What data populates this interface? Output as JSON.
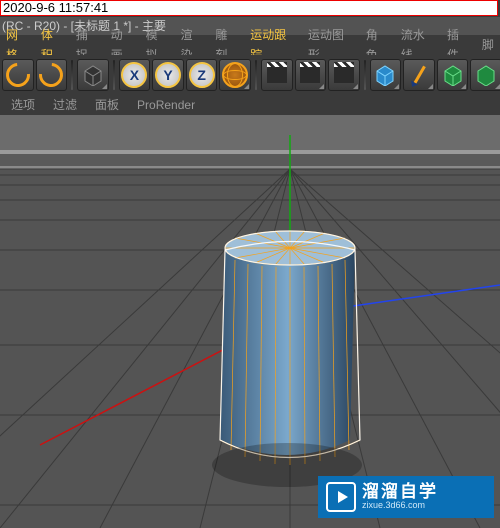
{
  "timestamp": "2020-9-6 11:57:41",
  "window_title": "(RC - R20) - [未标题 1 *] - 主要",
  "menu": {
    "items": [
      "网格",
      "体积",
      "捕捉",
      "动画",
      "模拟",
      "渲染",
      "雕刻",
      "运动跟踪",
      "运动图形",
      "角色",
      "流水线",
      "插件",
      "脚"
    ],
    "highlighted_indexes": [
      0,
      1,
      7
    ]
  },
  "toolbar": {
    "undo_icon": "undo-icon",
    "redo_icon": "redo-icon",
    "cube_mode_icon": "cube-mode-icon",
    "axis_x": "X",
    "axis_y": "Y",
    "axis_z": "Z",
    "globe_icon": "coordinate-globe-icon",
    "clap1": "render-picture-icon",
    "clap2": "render-region-icon",
    "clap3": "render-settings-icon",
    "prim_cube": "primitive-cube-icon",
    "pen": "pen-tool-icon",
    "green_cube": "deformer-cube-icon",
    "extra": "generator-icon"
  },
  "subbar": {
    "items": [
      "选项",
      "过滤",
      "面板",
      "ProRender"
    ]
  },
  "viewport": {
    "object_selected": "Cylinder",
    "axes": {
      "x_color": "#d11",
      "y_color": "#1c1",
      "z_color": "#24e"
    }
  },
  "watermark": {
    "brand": "溜溜自学",
    "url": "zixue.3d66.com"
  }
}
